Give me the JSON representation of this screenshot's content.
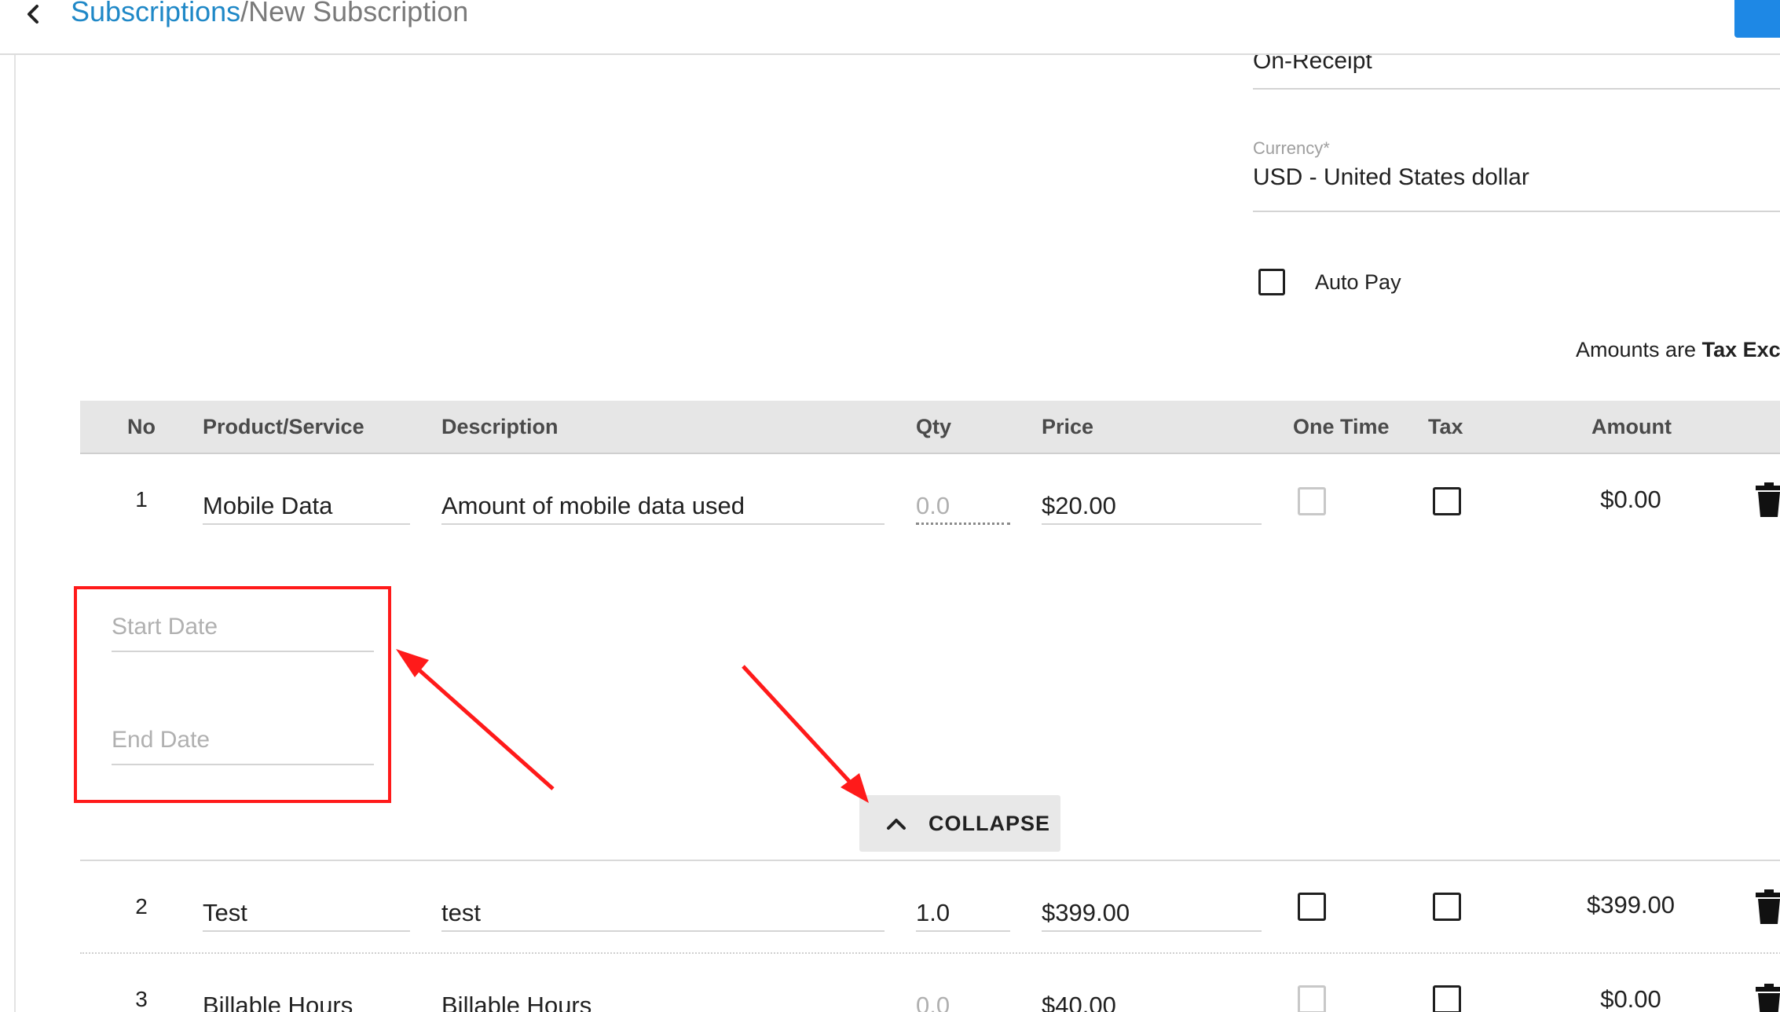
{
  "breadcrumb": {
    "parent": "Subscriptions",
    "separator": "/",
    "current": "New Subscription"
  },
  "form": {
    "payment_terms_value": "On-Receipt",
    "currency_label": "Currency*",
    "currency_value": "USD - United States dollar",
    "auto_pay_label": "Auto Pay",
    "auto_pay_checked": false,
    "tax_note_prefix": "Amounts are ",
    "tax_note_bold": "Tax Exc"
  },
  "table": {
    "headers": {
      "no": "No",
      "product": "Product/Service",
      "description": "Description",
      "qty": "Qty",
      "price": "Price",
      "one_time": "One Time",
      "tax": "Tax",
      "amount": "Amount"
    },
    "rows": [
      {
        "no": "1",
        "product": "Mobile Data",
        "description": "Amount of mobile data used",
        "qty": "0.0",
        "price": "$20.00",
        "one_time_disabled": true,
        "tax_checked": false,
        "amount": "$0.00"
      },
      {
        "no": "2",
        "product": "Test",
        "description": "test",
        "qty": "1.0",
        "price": "$399.00",
        "one_time_disabled": false,
        "tax_checked": false,
        "amount": "$399.00"
      },
      {
        "no": "3",
        "product": "Billable Hours",
        "description": "Billable Hours",
        "qty": "0.0",
        "price": "$40.00",
        "one_time_disabled": true,
        "tax_checked": false,
        "amount": "$0.00"
      }
    ],
    "expanded": {
      "start_date_placeholder": "Start Date",
      "end_date_placeholder": "End Date",
      "collapse_label": "COLLAPSE"
    }
  },
  "colors": {
    "link": "#1f88c7",
    "accent": "#1e88e5",
    "annotation": "#ff1a1a",
    "header_bg": "#e6e6e6"
  },
  "icons": {
    "back": "chevron-left-icon",
    "collapse": "chevron-up-icon",
    "delete": "trash-icon"
  }
}
